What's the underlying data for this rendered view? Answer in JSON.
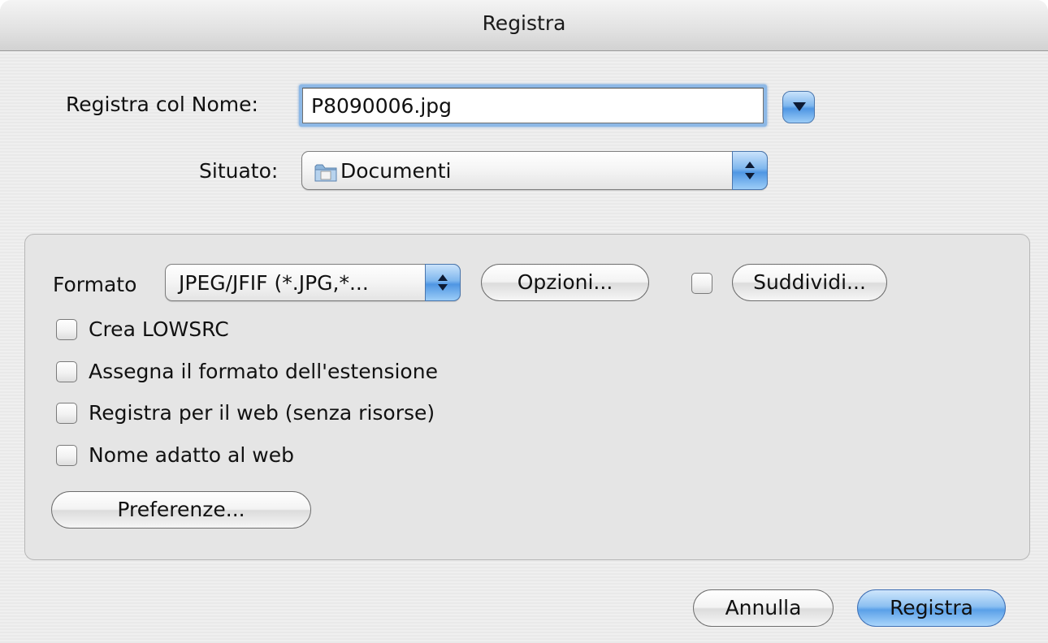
{
  "window": {
    "title": "Registra"
  },
  "save_as": {
    "label": "Registra col Nome:",
    "value": "P8090006.jpg"
  },
  "location": {
    "label": "Situato:",
    "value": "Documenti"
  },
  "format": {
    "label": "Formato",
    "value": "JPEG/JFIF (*.JPG,*...",
    "options_button": "Opzioni...",
    "split_button": "Suddividi...",
    "split_checked": false
  },
  "checkboxes": [
    {
      "label": "Crea LOWSRC",
      "checked": false
    },
    {
      "label": "Assegna il formato dell'estensione",
      "checked": false
    },
    {
      "label": "Registra per il web (senza risorse)",
      "checked": false
    },
    {
      "label": "Nome adatto al web",
      "checked": false
    }
  ],
  "preferences_button": "Preferenze...",
  "buttons": {
    "cancel": "Annulla",
    "save": "Registra"
  },
  "colors": {
    "accent": "#5aa0e8",
    "focus_ring": "#8db8e6"
  }
}
